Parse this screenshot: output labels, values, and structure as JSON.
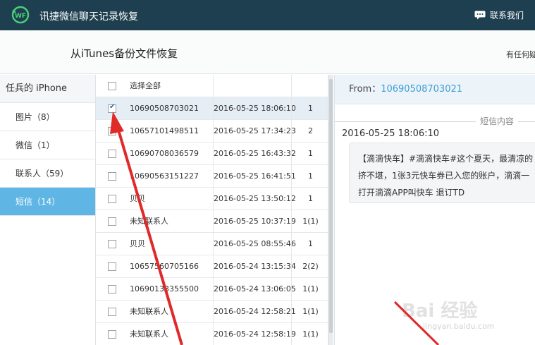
{
  "header": {
    "app_title": "讯捷微信聊天记录恢复",
    "contact_label": "联系我们",
    "logo_text": "WF"
  },
  "subheader": {
    "title": "从iTunes备份文件恢复",
    "help_text": "有任何疑"
  },
  "sidebar": {
    "device": "任兵的 iPhone",
    "items": [
      {
        "label": "图片（8）"
      },
      {
        "label": "微信（1）"
      },
      {
        "label": "联系人（59）"
      },
      {
        "label": "短信（14）"
      }
    ]
  },
  "list": {
    "select_all": "选择全部",
    "rows": [
      {
        "number": "10690508703021",
        "time": "2016-05-25 18:06:10",
        "count": "1",
        "checked": true
      },
      {
        "number": "10657101498511",
        "time": "2016-05-25 17:34:23",
        "count": "2",
        "checked": false
      },
      {
        "number": "10690708036579",
        "time": "2016-05-25 16:43:32",
        "count": "1",
        "checked": false
      },
      {
        "number": "10690563151227",
        "time": "2016-05-25 16:41:51",
        "count": "1",
        "checked": false
      },
      {
        "number": "贝贝",
        "time": "2016-05-25 13:50:12",
        "count": "1",
        "checked": false
      },
      {
        "number": "未知联系人",
        "time": "2016-05-25 10:37:19",
        "count": "1(1)",
        "checked": false
      },
      {
        "number": "贝贝",
        "time": "2016-05-25 08:55:46",
        "count": "1",
        "checked": false
      },
      {
        "number": "10657560705166",
        "time": "2016-05-24 13:15:34",
        "count": "2(2)",
        "checked": false
      },
      {
        "number": "10690133355500",
        "time": "2016-05-24 13:06:05",
        "count": "1(1)",
        "checked": false
      },
      {
        "number": "未知联系人",
        "time": "2016-05-24 12:58:21",
        "count": "1(1)",
        "checked": false
      },
      {
        "number": "未知联系人",
        "time": "2016-05-24 12:58:19",
        "count": "1(1)",
        "checked": false
      }
    ]
  },
  "detail": {
    "from_label": "From：",
    "from_number": "10690508703021",
    "section_label": "短信内容",
    "message_time": "2016-05-25 18:06:10",
    "message_text": "【滴滴快车】#滴滴快车#这个夏天，最清凉的挤不堪，1张3元快车券已入您的账户，滴滴一打开滴滴APP叫快车 退订TD"
  },
  "watermark": {
    "text": "Bai 经验",
    "sub": "jingyan.baidu.com"
  },
  "colors": {
    "topbar": "#1e3f4f",
    "active_tab": "#5fb6e4",
    "link_blue": "#3c9cd6",
    "arrow_red": "#e02a2a"
  }
}
